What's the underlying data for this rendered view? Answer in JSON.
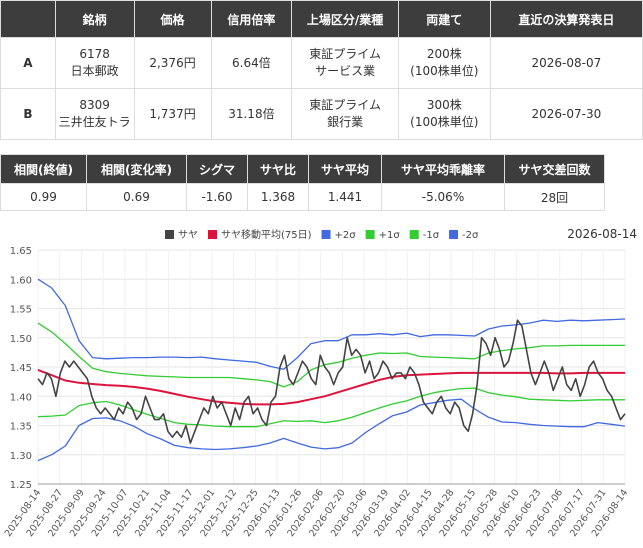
{
  "table1": {
    "headers": [
      "",
      "銘柄",
      "価格",
      "信用倍率",
      "上場区分/業種",
      "両建て",
      "直近の決算発表日"
    ],
    "rows": [
      {
        "key": "A",
        "code": "6178",
        "name": "日本郵政",
        "price": "2,376円",
        "ratio": "6.64倍",
        "market": "東証プライム",
        "sector": "サービス業",
        "qty": "200株",
        "unit": "(100株単位)",
        "date": "2026-08-07"
      },
      {
        "key": "B",
        "code": "8309",
        "name": "三井住友トラ",
        "price": "1,737円",
        "ratio": "31.18倍",
        "market": "東証プライム",
        "sector": "銀行業",
        "qty": "300株",
        "unit": "(100株単位)",
        "date": "2026-07-30"
      }
    ]
  },
  "table2": {
    "headers": [
      "相関(終値)",
      "相関(変化率)",
      "シグマ",
      "サヤ比",
      "サヤ平均",
      "サヤ平均乖離率",
      "サヤ交差回数"
    ],
    "values": [
      "0.99",
      "0.69",
      "-1.60",
      "1.368",
      "1.441",
      "-5.06%",
      "28回"
    ]
  },
  "chart_data": {
    "type": "line",
    "date_label": "2026-08-14",
    "ylim": [
      1.25,
      1.65
    ],
    "yticks": [
      "1.25",
      "1.30",
      "1.35",
      "1.40",
      "1.45",
      "1.50",
      "1.55",
      "1.60",
      "1.65"
    ],
    "xticks": [
      "2025-08-14",
      "2025-08-27",
      "2025-09-09",
      "2025-09-24",
      "2025-10-07",
      "2025-10-21",
      "2025-11-04",
      "2025-11-17",
      "2025-12-01",
      "2025-12-12",
      "2025-12-25",
      "2026-01-13",
      "2026-01-26",
      "2026-02-06",
      "2026-02-20",
      "2026-03-06",
      "2026-03-19",
      "2026-04-02",
      "2026-04-15",
      "2026-04-28",
      "2026-05-15",
      "2026-05-28",
      "2026-06-10",
      "2026-06-23",
      "2026-07-06",
      "2026-07-17",
      "2026-07-31",
      "2026-08-14"
    ],
    "legend": [
      {
        "name": "サヤ",
        "color": "#444444"
      },
      {
        "name": "サヤ移動平均(75日)",
        "color": "#dc143c"
      },
      {
        "name": "+2σ",
        "color": "#4169e1"
      },
      {
        "name": "+1σ",
        "color": "#32cd32"
      },
      {
        "name": "-1σ",
        "color": "#32cd32"
      },
      {
        "name": "-2σ",
        "color": "#4169e1"
      }
    ],
    "series": {
      "saya": [
        1.43,
        1.42,
        1.44,
        1.43,
        1.4,
        1.44,
        1.46,
        1.45,
        1.46,
        1.45,
        1.44,
        1.43,
        1.4,
        1.38,
        1.37,
        1.38,
        1.37,
        1.36,
        1.38,
        1.37,
        1.39,
        1.38,
        1.36,
        1.37,
        1.4,
        1.38,
        1.36,
        1.36,
        1.37,
        1.34,
        1.33,
        1.34,
        1.33,
        1.35,
        1.32,
        1.34,
        1.36,
        1.38,
        1.37,
        1.4,
        1.38,
        1.39,
        1.37,
        1.35,
        1.38,
        1.36,
        1.39,
        1.4,
        1.37,
        1.38,
        1.36,
        1.35,
        1.39,
        1.4,
        1.45,
        1.47,
        1.43,
        1.42,
        1.44,
        1.46,
        1.45,
        1.43,
        1.42,
        1.47,
        1.45,
        1.44,
        1.42,
        1.44,
        1.45,
        1.5,
        1.47,
        1.48,
        1.47,
        1.44,
        1.46,
        1.43,
        1.44,
        1.46,
        1.45,
        1.43,
        1.44,
        1.44,
        1.43,
        1.45,
        1.44,
        1.42,
        1.39,
        1.38,
        1.37,
        1.39,
        1.4,
        1.38,
        1.37,
        1.39,
        1.38,
        1.35,
        1.34,
        1.37,
        1.42,
        1.5,
        1.49,
        1.47,
        1.5,
        1.48,
        1.45,
        1.46,
        1.49,
        1.53,
        1.52,
        1.48,
        1.44,
        1.42,
        1.44,
        1.46,
        1.44,
        1.41,
        1.43,
        1.45,
        1.42,
        1.41,
        1.43,
        1.4,
        1.42,
        1.45,
        1.46,
        1.44,
        1.43,
        1.41,
        1.4,
        1.38,
        1.36,
        1.37
      ],
      "ma": [
        1.445,
        1.436,
        1.427,
        1.423,
        1.421,
        1.419,
        1.418,
        1.416,
        1.413,
        1.409,
        1.404,
        1.399,
        1.395,
        1.391,
        1.389,
        1.387,
        1.386,
        1.386,
        1.387,
        1.39,
        1.395,
        1.4,
        1.407,
        1.414,
        1.421,
        1.428,
        1.433,
        1.436,
        1.437,
        1.438,
        1.439,
        1.44,
        1.44,
        1.44,
        1.44,
        1.44,
        1.44,
        1.44,
        1.439,
        1.439,
        1.44,
        1.44,
        1.44,
        1.44
      ],
      "p2": [
        1.6,
        1.585,
        1.555,
        1.495,
        1.466,
        1.464,
        1.465,
        1.466,
        1.466,
        1.467,
        1.467,
        1.466,
        1.467,
        1.464,
        1.462,
        1.46,
        1.458,
        1.451,
        1.446,
        1.466,
        1.49,
        1.495,
        1.495,
        1.505,
        1.505,
        1.507,
        1.505,
        1.508,
        1.502,
        1.505,
        1.505,
        1.504,
        1.503,
        1.515,
        1.52,
        1.522,
        1.525,
        1.53,
        1.528,
        1.53,
        1.529,
        1.53,
        1.531,
        1.532
      ],
      "p1": [
        1.525,
        1.51,
        1.49,
        1.468,
        1.448,
        1.442,
        1.439,
        1.437,
        1.435,
        1.434,
        1.433,
        1.432,
        1.432,
        1.432,
        1.432,
        1.43,
        1.428,
        1.425,
        1.416,
        1.425,
        1.445,
        1.454,
        1.458,
        1.465,
        1.47,
        1.474,
        1.473,
        1.474,
        1.468,
        1.467,
        1.466,
        1.465,
        1.464,
        1.474,
        1.478,
        1.481,
        1.483,
        1.486,
        1.486,
        1.487,
        1.487,
        1.487,
        1.487,
        1.487
      ],
      "m1": [
        1.365,
        1.366,
        1.368,
        1.384,
        1.389,
        1.391,
        1.385,
        1.377,
        1.369,
        1.362,
        1.355,
        1.352,
        1.351,
        1.349,
        1.348,
        1.348,
        1.348,
        1.353,
        1.358,
        1.357,
        1.358,
        1.355,
        1.358,
        1.364,
        1.372,
        1.38,
        1.387,
        1.392,
        1.4,
        1.406,
        1.41,
        1.413,
        1.414,
        1.406,
        1.402,
        1.399,
        1.395,
        1.394,
        1.393,
        1.392,
        1.393,
        1.394,
        1.394,
        1.394
      ],
      "m2": [
        1.29,
        1.3,
        1.315,
        1.35,
        1.362,
        1.363,
        1.358,
        1.349,
        1.336,
        1.327,
        1.316,
        1.312,
        1.31,
        1.309,
        1.31,
        1.312,
        1.315,
        1.32,
        1.328,
        1.32,
        1.313,
        1.31,
        1.312,
        1.32,
        1.338,
        1.353,
        1.367,
        1.373,
        1.385,
        1.389,
        1.393,
        1.395,
        1.378,
        1.364,
        1.356,
        1.355,
        1.352,
        1.35,
        1.349,
        1.348,
        1.348,
        1.355,
        1.352,
        1.349
      ]
    }
  }
}
